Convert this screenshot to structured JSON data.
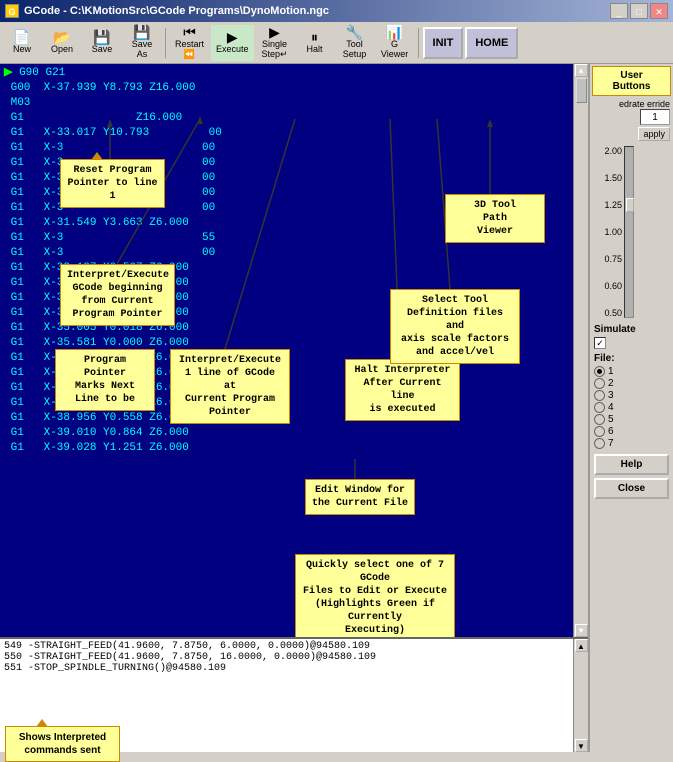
{
  "titleBar": {
    "title": "GCode - C:\\KMotionSrc\\GCode Programs\\DynoMotion.ngc",
    "controls": [
      "_",
      "□",
      "✕"
    ]
  },
  "toolbar": {
    "buttons": [
      {
        "label": "New",
        "icon": "📄"
      },
      {
        "label": "Open",
        "icon": "📂"
      },
      {
        "label": "Save",
        "icon": "💾"
      },
      {
        "label": "Save\nAs",
        "icon": "💾"
      },
      {
        "label": "Restart",
        "icon": "⏪"
      },
      {
        "label": "Execute",
        "icon": "▶"
      },
      {
        "label": "Single\nStep",
        "icon": "▶|"
      },
      {
        "label": "Halt",
        "icon": "⏸"
      },
      {
        "label": "Tool\nSetup",
        "icon": "🔧"
      },
      {
        "label": "G\nViewer",
        "icon": "📊"
      }
    ],
    "init": "INIT",
    "home": "HOME"
  },
  "gcodeLines": [
    {
      "text": "G90 G21",
      "arrow": true
    },
    {
      "text": "G00  X-37.939 Y8.793 Z16.000"
    },
    {
      "text": "M03"
    },
    {
      "text": "G1  Z16.000"
    },
    {
      "text": "G1  X-33.017 Y10.793         00"
    },
    {
      "text": "G1  X-3                      00"
    },
    {
      "text": "G1  X-3                      00"
    },
    {
      "text": "G1  X-3                      00"
    },
    {
      "text": "G1  X-3                      00"
    },
    {
      "text": "G1  X-3                      00"
    },
    {
      "text": "G1  X-31.549 Y3.663 Z6.000"
    },
    {
      "text": "G1  X-3                    55"
    },
    {
      "text": "G1  X-3                      00"
    },
    {
      "text": "G1  X-33.187 X0.567 Z6.000"
    },
    {
      "text": "G1  X-33.592 Y0.351 Z6.000"
    },
    {
      "text": "G1  X-34.024 Y0.180 Z6.000"
    },
    {
      "text": "G1  X-34.492 Y0.081 Z6.000"
    },
    {
      "text": "G1  X-35.005 Y0.018 Z6.000"
    },
    {
      "text": "G1  X-35.581 Y0.000 Z6.000"
    },
    {
      "text": "G1  X-37.903 Y0.000 Z6.000"
    },
    {
      "text": "G1  X-38.326 Y0.036 Z6.000"
    },
    {
      "text": "G1  X-38.632 Y0.144 Z6.000"
    },
    {
      "text": "G1  X-38.839 Y0.324 Z6.000"
    },
    {
      "text": "G1  X-38.956 Y0.558 Z6.000"
    },
    {
      "text": "G1  X-39.010 Y0.864 Z6.000"
    },
    {
      "text": "G1  X-39.028 Y1.251 Z6.000"
    }
  ],
  "consoleLines": [
    "549 -STRAIGHT_FEED(41.9600, 7.8750, 6.0000, 0.0000)@94580.109",
    "550 -STRAIGHT_FEED(41.9600, 7.8750, 16.0000, 0.0000)@94580.109",
    "551 -STOP_SPINDLE_TURNING()@94580.109"
  ],
  "tooltips": {
    "resetPointer": "Reset Program\nPointer to line\n1",
    "interpretExecute": "Interpret/Execute\nGCode beginning\nfrom Current\nProgram Pointer",
    "programPointer": "Program\nPointer\nMarks Next\nLine to be",
    "singleStep": "Interpret/Execute\n1 line of GCode at\nCurrent Program\nPointer",
    "haltInterpreter": "Halt Interpreter\nAfter Current line\nis executed",
    "toolPath": "3D Tool\nPath\nViewer",
    "toolDefinition": "Select Tool\nDefinition files and\naxis scale factors\nand accel/vel",
    "editWindow": "Edit Window for\nthe Current File",
    "fileSelect": "Quickly select one of 7 GCode\nFiles to Edit or Execute\n(Highlights Green if Currently\nExecuting)",
    "userButtons": "User\nButtons",
    "showsInterpreted": "Shows Interpreted\ncommands sent",
    "interpreterAfter": "Interpreter After Current line executed"
  },
  "rightPanel": {
    "overrideLabel": "edrate\nerride",
    "overrideValue": "1",
    "applyLabel": "apply",
    "sliderValues": [
      "2.00",
      "1.50",
      "1.25",
      "1.00",
      "0.75",
      "0.60",
      "0.50"
    ],
    "simulateLabel": "Simulate",
    "simulateChecked": true,
    "fileLabel": "File:",
    "fileOptions": [
      "1",
      "2",
      "3",
      "4",
      "5",
      "6",
      "7"
    ],
    "selectedFile": "1",
    "helpLabel": "Help",
    "closeLabel": "Close"
  }
}
